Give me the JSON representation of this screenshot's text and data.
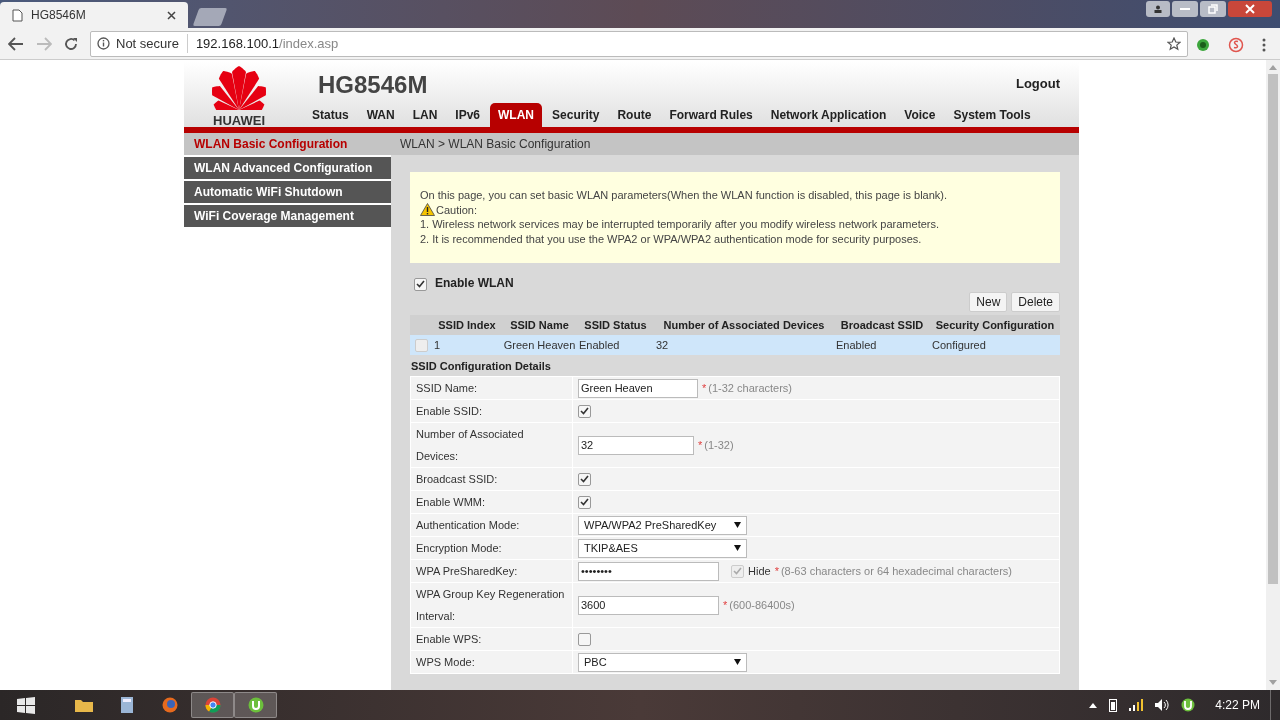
{
  "browser": {
    "tab_title": "HG8546M",
    "security": "Not secure",
    "host": "192.168.100.1",
    "path": "/index.asp"
  },
  "router": {
    "model": "HG8546M",
    "brand": "HUAWEI",
    "logout": "Logout",
    "nav": [
      {
        "label": "Status",
        "selected": false
      },
      {
        "label": "WAN",
        "selected": false
      },
      {
        "label": "LAN",
        "selected": false
      },
      {
        "label": "IPv6",
        "selected": false
      },
      {
        "label": "WLAN",
        "selected": true
      },
      {
        "label": "Security",
        "selected": false
      },
      {
        "label": "Route",
        "selected": false
      },
      {
        "label": "Forward Rules",
        "selected": false
      },
      {
        "label": "Network Application",
        "selected": false
      },
      {
        "label": "Voice",
        "selected": false
      },
      {
        "label": "System Tools",
        "selected": false
      }
    ],
    "sidebar": [
      {
        "label": "WLAN Basic Configuration",
        "selected": true
      },
      {
        "label": "WLAN Advanced Configuration",
        "selected": false
      },
      {
        "label": "Automatic WiFi Shutdown",
        "selected": false
      },
      {
        "label": "WiFi Coverage Management",
        "selected": false
      }
    ],
    "breadcrumb": "WLAN > WLAN Basic Configuration",
    "notice": {
      "intro": "On this page, you can set basic WLAN parameters(When the WLAN function is disabled, this page is blank).",
      "caution": "Caution:",
      "lines": [
        "1. Wireless network services may be interrupted temporarily after you modify wireless network parameters.",
        "2. It is recommended that you use the WPA2 or WPA/WPA2 authentication mode for security purposes."
      ]
    },
    "enable_wlan": {
      "label": "Enable WLAN",
      "checked": true
    },
    "buttons": [
      "New",
      "Delete"
    ],
    "ssid_table": {
      "columns": [
        "SSID Index",
        "SSID Name",
        "SSID Status",
        "Number of Associated Devices",
        "Broadcast SSID",
        "Security Configuration"
      ],
      "rows": [
        {
          "checked": false,
          "cells": [
            "1",
            "Green Heaven",
            "Enabled",
            "32",
            "Enabled",
            "Configured"
          ]
        }
      ]
    },
    "details": {
      "title": "SSID Configuration Details",
      "fields": [
        {
          "kind": "text",
          "label": "SSID Name:",
          "value": "Green Heaven",
          "mark": "*",
          "hint": "(1-32 characters)"
        },
        {
          "kind": "checkbox",
          "label": "Enable SSID:",
          "checked": true
        },
        {
          "kind": "text",
          "label": "Number of Associated Devices:",
          "value": "32",
          "mark": "*",
          "hint": "(1-32)"
        },
        {
          "kind": "checkbox",
          "label": "Broadcast SSID:",
          "checked": true
        },
        {
          "kind": "checkbox",
          "label": "Enable WMM:",
          "checked": true
        },
        {
          "kind": "select",
          "label": "Authentication Mode:",
          "value": "WPA/WPA2 PreSharedKey"
        },
        {
          "kind": "select",
          "label": "Encryption Mode:",
          "value": "TKIP&AES"
        },
        {
          "kind": "password",
          "label": "WPA PreSharedKey:",
          "value": "••••••••",
          "hide_label": "Hide",
          "hide_checked": true,
          "mark": "*",
          "hint": "(8-63 characters or 64 hexadecimal characters)"
        },
        {
          "kind": "text",
          "label": "WPA Group Key Regeneration Interval:",
          "value": "3600",
          "mark": "*",
          "hint": "(600-86400s)"
        },
        {
          "kind": "checkbox",
          "label": "Enable WPS:",
          "checked": false
        },
        {
          "kind": "select",
          "label": "WPS Mode:",
          "value": "PBC"
        }
      ]
    }
  },
  "taskbar": {
    "time": "4:22 PM"
  }
}
